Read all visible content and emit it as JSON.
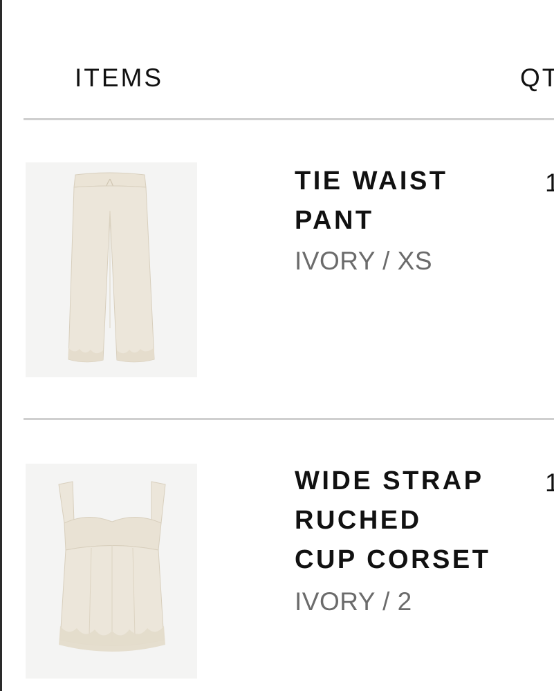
{
  "header": {
    "items_label": "ITEMS",
    "qty_label": "QT"
  },
  "items": [
    {
      "name_line1": "TIE WAIST",
      "name_line2": "PANT",
      "variant": "IVORY / XS",
      "qty": "1",
      "image": "ivory-tie-waist-pant"
    },
    {
      "name_line1": "WIDE STRAP",
      "name_line2": "RUCHED",
      "name_line3": "CUP CORSET",
      "variant": "IVORY / 2",
      "qty": "1",
      "image": "ivory-corset-top"
    }
  ],
  "colors": {
    "divider": "#cfcfcf",
    "text": "#111111",
    "variant_text": "#6b6b6b",
    "thumb_bg": "#f4f4f3",
    "garment": "#ece6da"
  }
}
